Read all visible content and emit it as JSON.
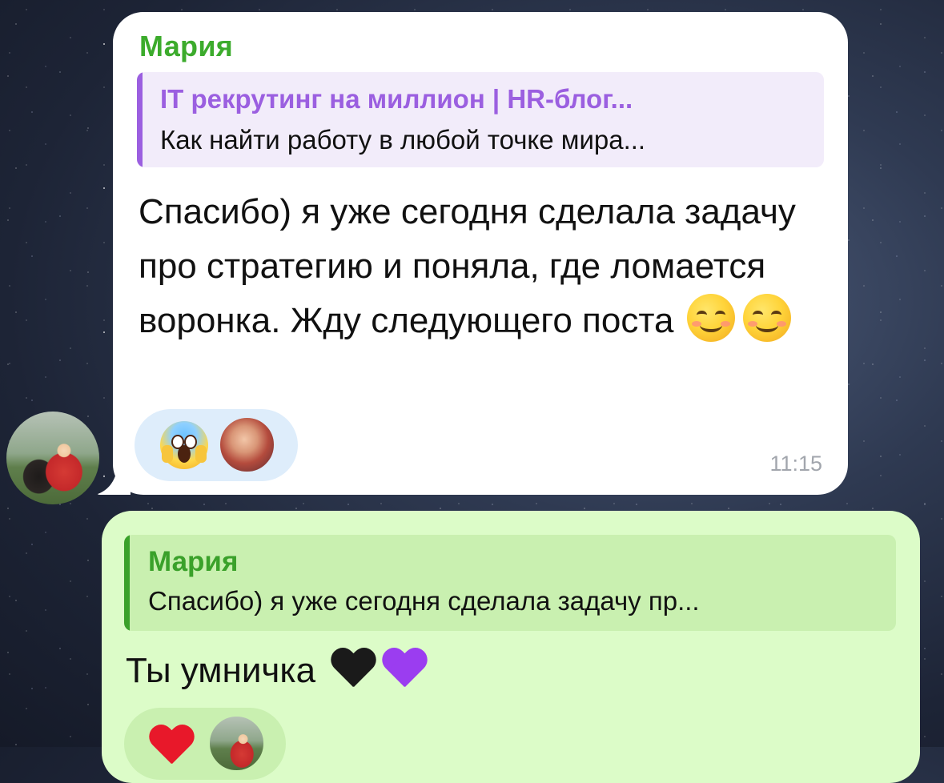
{
  "colors": {
    "incoming_bubble": "#ffffff",
    "outgoing_bubble": "#dcfcc8",
    "sender_name": "#3cab2c",
    "channel_quote_accent": "#9b5fe0",
    "reply_quote_accent": "#3aa12a",
    "timestamp": "#a2a6ad"
  },
  "incoming_message": {
    "sender": "Мария",
    "quote": {
      "title": "IT рекрутинг на миллион | HR-блог...",
      "text": "Как найти работу в любой точке мира..."
    },
    "text": "Спасибо) я уже сегодня сделала задачу про стратегию и поняла, где ломается воронка. Жду следующего поста",
    "emojis": [
      "smiling-face-icon",
      "relieved-face-icon"
    ],
    "reactions": [
      "face-screaming-in-fear-icon"
    ],
    "time": "11:15"
  },
  "outgoing_message": {
    "quote": {
      "title": "Мария",
      "text": "Спасибо) я уже сегодня сделала задачу пр..."
    },
    "text": "Ты умничка",
    "emojis": [
      "black-heart-icon",
      "purple-heart-icon"
    ],
    "reactions": [
      "red-heart-icon"
    ]
  }
}
